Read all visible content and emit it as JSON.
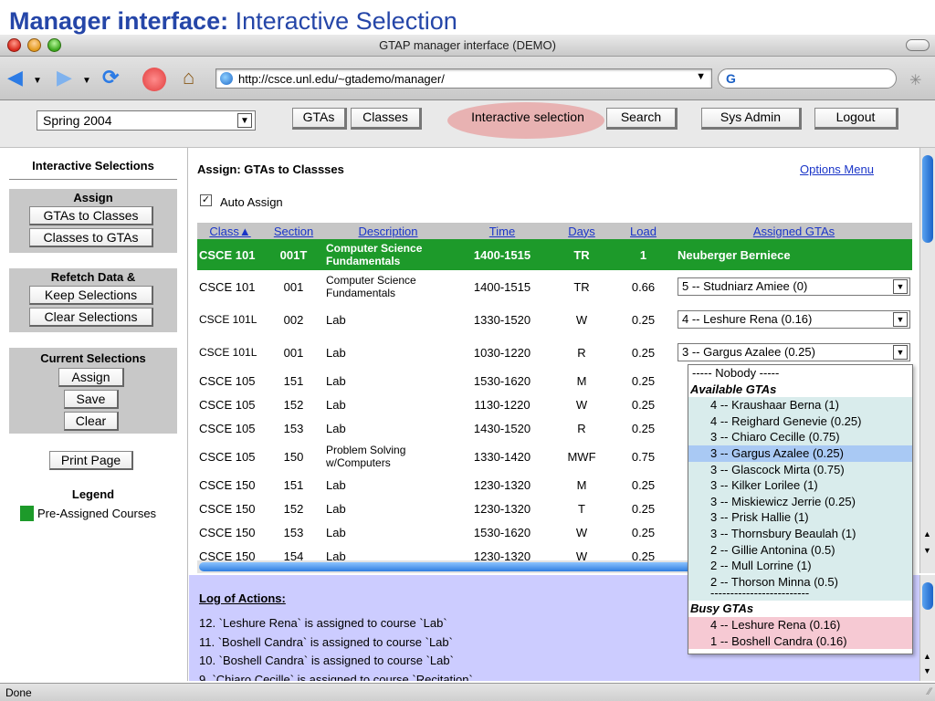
{
  "slide": {
    "title_bold": "Manager interface:",
    "title_rest": "Interactive Selection"
  },
  "window": {
    "title": "GTAP manager interface (DEMO)"
  },
  "browser": {
    "url": "http://csce.unl.edu/~gtademo/manager/",
    "search_logo": "G"
  },
  "nav": {
    "semester": "Spring 2004",
    "buttons": [
      "GTAs",
      "Classes",
      "Interactive selection",
      "Search",
      "Sys Admin",
      "Logout"
    ]
  },
  "left_panel": {
    "title": "Interactive Selections",
    "assign": {
      "title": "Assign",
      "b1": "GTAs to Classes",
      "b2": "Classes to GTAs"
    },
    "refetch": {
      "title": "Refetch Data &",
      "b1": "Keep Selections",
      "b2": "Clear Selections"
    },
    "current": {
      "title": "Current Selections",
      "b1": "Assign",
      "b2": "Save",
      "b3": "Clear"
    },
    "print": "Print Page",
    "legend_title": "Legend",
    "legend_item": "Pre-Assigned Courses",
    "legend_color": "#1d9a2a"
  },
  "main": {
    "heading": "Assign: GTAs to Classses",
    "options_link": "Options Menu",
    "auto_assign": "Auto Assign",
    "columns": [
      "Class▲",
      "Section",
      "Description",
      "Time",
      "Days",
      "Load",
      "Assigned GTAs"
    ],
    "rows": [
      {
        "cls": "CSCE 101",
        "sec": "001T",
        "desc": "Computer Science Fundamentals",
        "time": "1400-1515",
        "days": "TR",
        "load": "1",
        "gta": "Neuberger Berniece"
      },
      {
        "cls": "CSCE 101",
        "sec": "001",
        "desc": "Computer Science Fundamentals",
        "time": "1400-1515",
        "days": "TR",
        "load": "0.66",
        "gta": "5 -- Studniarz Amiee (0)"
      },
      {
        "cls": "CSCE 101L",
        "sec": "002",
        "desc": "Lab",
        "time": "1330-1520",
        "days": "W",
        "load": "0.25",
        "gta": "4 -- Leshure Rena (0.16)"
      },
      {
        "cls": "CSCE 101L",
        "sec": "001",
        "desc": "Lab",
        "time": "1030-1220",
        "days": "R",
        "load": "0.25",
        "gta": "3 -- Gargus Azalee (0.25)"
      },
      {
        "cls": "CSCE 105",
        "sec": "151",
        "desc": "Lab",
        "time": "1530-1620",
        "days": "M",
        "load": "0.25",
        "gta": ""
      },
      {
        "cls": "CSCE 105",
        "sec": "152",
        "desc": "Lab",
        "time": "1130-1220",
        "days": "W",
        "load": "0.25",
        "gta": ""
      },
      {
        "cls": "CSCE 105",
        "sec": "153",
        "desc": "Lab",
        "time": "1430-1520",
        "days": "R",
        "load": "0.25",
        "gta": ""
      },
      {
        "cls": "CSCE 105",
        "sec": "150",
        "desc": "Problem Solving w/Computers",
        "time": "1330-1420",
        "days": "MWF",
        "load": "0.75",
        "gta": ""
      },
      {
        "cls": "CSCE 150",
        "sec": "151",
        "desc": "Lab",
        "time": "1230-1320",
        "days": "M",
        "load": "0.25",
        "gta": ""
      },
      {
        "cls": "CSCE 150",
        "sec": "152",
        "desc": "Lab",
        "time": "1230-1320",
        "days": "T",
        "load": "0.25",
        "gta": ""
      },
      {
        "cls": "CSCE 150",
        "sec": "153",
        "desc": "Lab",
        "time": "1530-1620",
        "days": "W",
        "load": "0.25",
        "gta": ""
      },
      {
        "cls": "CSCE 150",
        "sec": "154",
        "desc": "Lab",
        "time": "1230-1320",
        "days": "W",
        "load": "0.25",
        "gta": ""
      }
    ]
  },
  "dropdown": {
    "nobody": "----- Nobody -----",
    "available_title": "Available GTAs",
    "available": [
      "4 -- Kraushaar Berna (1)",
      "4 -- Reighard Genevie (0.25)",
      "3 -- Chiaro Cecille (0.75)",
      "3 -- Gargus Azalee (0.25)",
      "3 -- Glascock Mirta (0.75)",
      "3 -- Kilker Lorilee (1)",
      "3 -- Miskiewicz Jerrie (0.25)",
      "3 -- Prisk Hallie (1)",
      "3 -- Thornsbury Beaulah (1)",
      "2 -- Gillie Antonina (0.5)",
      "2 -- Mull Lorrine (1)",
      "2 -- Thorson Minna (0.5)"
    ],
    "selected": "3 -- Gargus Azalee (0.25)",
    "separator": "-------------------------",
    "busy_title": "Busy GTAs",
    "busy": [
      "4 -- Leshure Rena (0.16)",
      "1 -- Boshell Candra (0.16)"
    ]
  },
  "log": {
    "title": "Log of Actions:",
    "lines": [
      "12. `Leshure Rena` is assigned to course `Lab`",
      "11. `Boshell Candra` is assigned to course `Lab`",
      "10. `Boshell Candra` is assigned to course `Lab`",
      "9. `Chiaro Cecille` is assigned to course `Recitation`"
    ]
  },
  "status": "Done"
}
